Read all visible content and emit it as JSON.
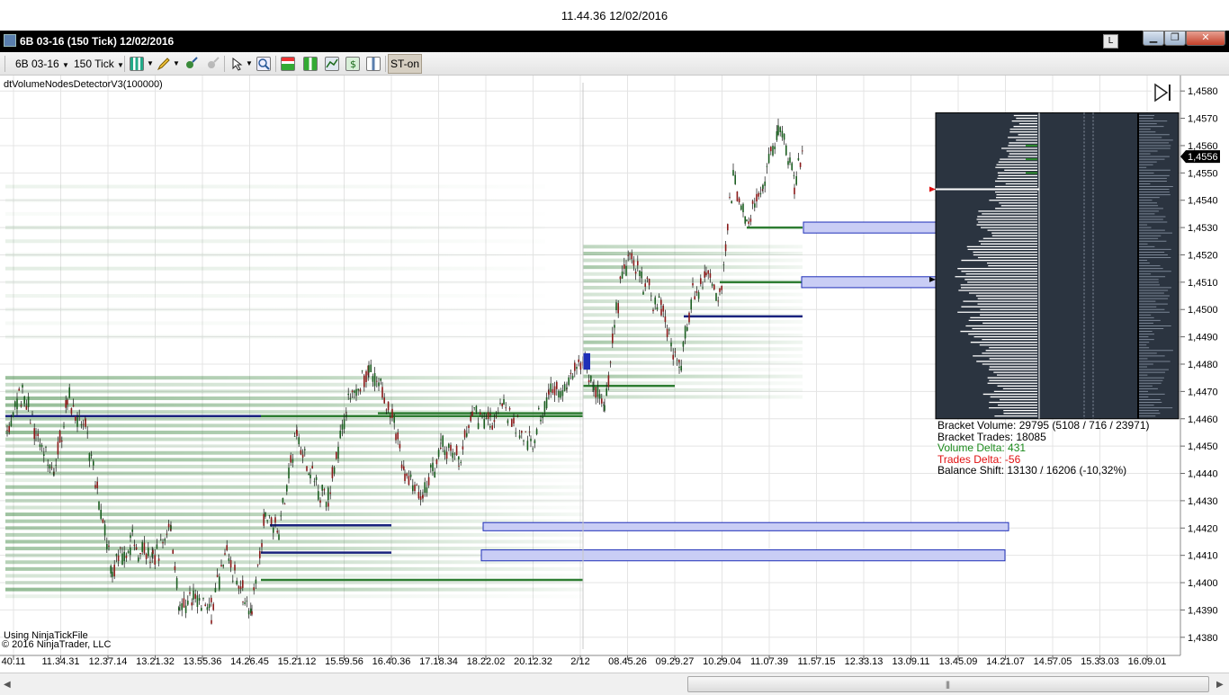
{
  "clock": "11.44.36 12/02/2016",
  "window": {
    "title": "6B 03-16 (150 Tick)  12/02/2016",
    "l_button": "L",
    "min_glyph": "▁",
    "max_glyph": "❐",
    "close_glyph": "✕"
  },
  "toolbar": {
    "instrument": "6B 03-16",
    "interval": "150 Tick",
    "st_button": "ST-on"
  },
  "indicator_label": "dtVolumeNodesDetectorV3(100000)",
  "price_axis": {
    "labels": [
      "1,4580",
      "1,4570",
      "1,4560",
      "1,4550",
      "1,4540",
      "1,4530",
      "1,4520",
      "1,4510",
      "1,4500",
      "1,4490",
      "1,4480",
      "1,4470",
      "1,4460",
      "1,4450",
      "1,4440",
      "1,4430",
      "1,4420",
      "1,4410",
      "1,4400",
      "1,4390",
      "1,4380"
    ],
    "current_price": "1,4556",
    "min": 1.4375,
    "max": 1.4585
  },
  "time_axis": {
    "labels": [
      "40.11",
      "11.34.31",
      "12.37.14",
      "13.21.32",
      "13.55.36",
      "14.26.45",
      "15.21.12",
      "15.59.56",
      "16.40.36",
      "17.18.34",
      "18.22.02",
      "20.12.32",
      "2/12",
      "08.45.26",
      "09.29.27",
      "10.29.04",
      "11.07.39",
      "11.57.15",
      "12.33.13",
      "13.09.11",
      "13.45.09",
      "14.21.07",
      "14.57.05",
      "15.33.03",
      "16.09.01"
    ]
  },
  "info": {
    "bracket_volume": "Bracket Volume: 29795 (5108 / 716 / 23971)",
    "bracket_trades": "Bracket Trades: 18085",
    "volume_delta": "Volume Delta: 431",
    "trades_delta": "Trades Delta: -56",
    "balance_shift": "Balance Shift: 13130 / 16206 (-10,32%)"
  },
  "footer": {
    "line1": "Using NinjaTickFile",
    "line2": "© 2016 NinjaTrader, LLC"
  },
  "scrollbar": {
    "left_arrow": "◀",
    "right_arrow": "▶",
    "grip": "|||"
  },
  "colors": {
    "node_green": "#2e7d32",
    "node_blue": "#1a237e",
    "up_bar": "#1b5e20",
    "down_bar": "#8b1a1a",
    "profile_bg": "#2b3440",
    "box_fill": "#c9cdf5",
    "box_stroke": "#1f2fb8",
    "volume_delta": "#1c8a1c",
    "trades_delta": "#e01010"
  }
}
